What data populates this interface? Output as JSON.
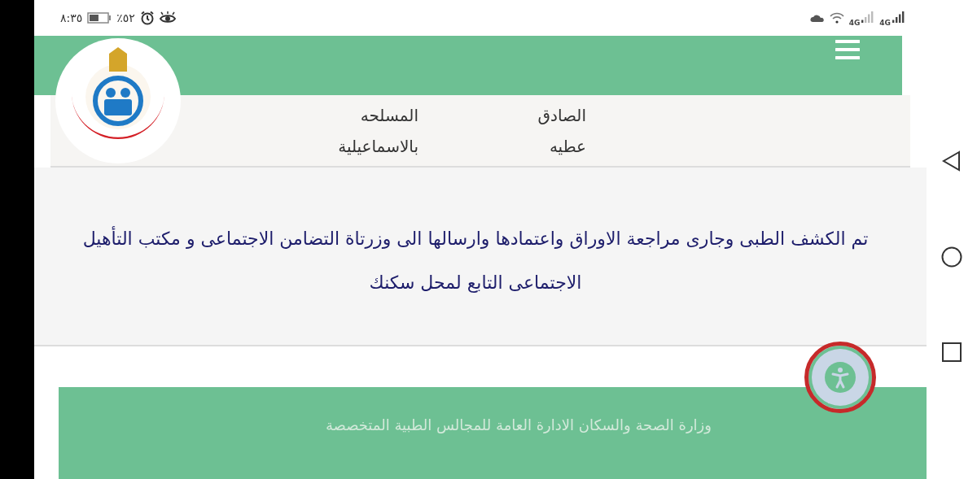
{
  "status_bar": {
    "time": "٨:٣٥",
    "battery": {
      "level": 0.52,
      "text": "٪٥٢"
    },
    "networks": [
      "4G",
      "4G"
    ]
  },
  "table": {
    "rows": [
      {
        "cells": [
          "الصادق",
          "المسلحه"
        ]
      },
      {
        "cells": [
          "عطيه",
          "بالاسماعيلية"
        ]
      }
    ]
  },
  "message": "تم الكشف الطبى وجارى مراجعة الاوراق واعتمادها وارسالها الى وزرتاة التضامن الاجتماعى و مكتب التأهيل الاجتماعى التابع لمحل سكنك",
  "footer": {
    "text": "وزارة الصحة والسكان الادارة العامة للمجالس الطبية المتخصصة"
  }
}
